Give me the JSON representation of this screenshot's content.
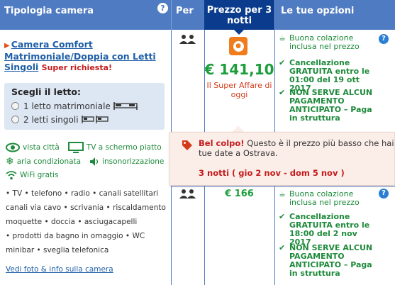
{
  "header": {
    "room_type": "Tipologia camera",
    "per": "Per",
    "price": "Prezzo per 3 notti",
    "options": "Le tue opzioni",
    "help": "?"
  },
  "room": {
    "title": "Camera Comfort Matrimoniale/Doppia con Letti Singoli",
    "badge": "Super richiesta!",
    "bed_title": "Scegli il letto:",
    "bed_options": [
      "1 letto matrimoniale",
      "2 letti singoli"
    ],
    "amenities": [
      "vista città",
      "TV a schermo piatto",
      "aria condizionata",
      "insonorizzazione",
      "WiFi gratis"
    ],
    "features": [
      "• TV  • telefono  • radio  • canali satellitari",
      "canali via cavo  • scrivania  • riscaldamento",
      "moquette  • doccia  • asciugacapelli",
      "• prodotti da bagno in omaggio  • WC",
      "minibar  • sveglia telefonica"
    ],
    "see_link": "Vedi foto & info sulla camera"
  },
  "offers": [
    {
      "price": "€ 141,10",
      "deal": "Il Super Affare di oggi",
      "breakfast": "Buona colazione inclusa nel prezzo",
      "cancellation": "Cancellazione GRATUITA entro le 01:00 del 19 ott 2017",
      "prepay": "NON SERVE ALCUN PAGAMENTO ANTICIPATO – Paga in struttura"
    },
    {
      "price": "€ 166",
      "breakfast": "Buona colazione inclusa nel prezzo",
      "cancellation": "Cancellazione GRATUITA entro le 18:00 del 2 nov 2017",
      "prepay": "NON SERVE ALCUN PAGAMENTO ANTICIPATO – Paga in struttura"
    }
  ],
  "popup": {
    "title": "Bel colpo!",
    "message_line1": "Questo è il prezzo più basso che hai v",
    "message_line2": "tue date a Ostrava.",
    "dates": "3 notti ( gio 2 nov - dom 5 nov )"
  },
  "colors": {
    "header": "#4f7bc2",
    "header_active": "#0a3b8c",
    "green": "#1e9e3b",
    "red": "#c31b1b"
  }
}
